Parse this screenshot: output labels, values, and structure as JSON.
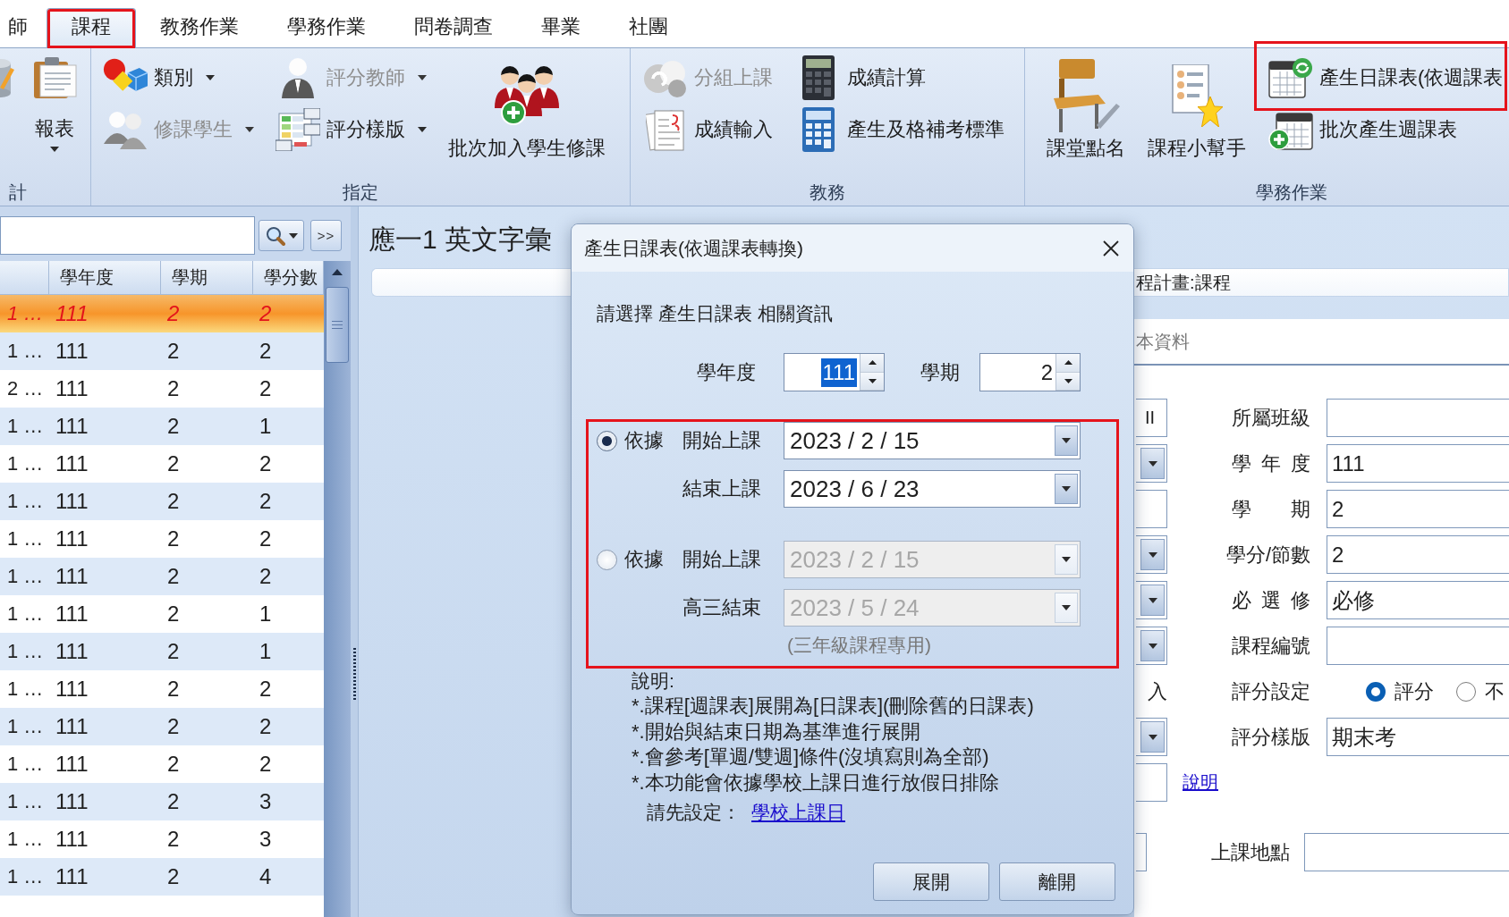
{
  "tabs": [
    {
      "label": "師",
      "selected": false,
      "highlighted": false
    },
    {
      "label": "課程",
      "selected": true,
      "highlighted": true
    },
    {
      "label": "教務作業",
      "selected": false,
      "highlighted": false
    },
    {
      "label": "學務作業",
      "selected": false,
      "highlighted": false
    },
    {
      "label": "問卷調查",
      "selected": false,
      "highlighted": false
    },
    {
      "label": "畢業",
      "selected": false,
      "highlighted": false
    },
    {
      "label": "社團",
      "selected": false,
      "highlighted": false
    }
  ],
  "ribbon": {
    "groups": [
      {
        "label": "計",
        "items": [
          {
            "kind": "large",
            "dropdown": false,
            "disabled": false,
            "highlighted": false
          },
          {
            "kind": "large",
            "label": "報表",
            "dropdown": true,
            "disabled": false,
            "highlighted": false
          }
        ]
      },
      {
        "label": "指定",
        "items": [
          {
            "kind": "small",
            "label": "類別",
            "dropdown": true,
            "disabled": false,
            "highlighted": false
          },
          {
            "kind": "small",
            "label": "修課學生",
            "dropdown": true,
            "disabled": true,
            "highlighted": false
          },
          {
            "kind": "small",
            "label": "評分教師",
            "dropdown": true,
            "disabled": true,
            "highlighted": false
          },
          {
            "kind": "small",
            "label": "評分樣版",
            "dropdown": true,
            "disabled": false,
            "highlighted": false
          },
          {
            "kind": "large",
            "label": "批次加入學生修課",
            "dropdown": false,
            "disabled": false,
            "highlighted": false
          }
        ]
      },
      {
        "label": "教務",
        "items": [
          {
            "kind": "small",
            "label": "分組上課",
            "dropdown": false,
            "disabled": true,
            "highlighted": false
          },
          {
            "kind": "small",
            "label": "成績輸入",
            "dropdown": false,
            "disabled": false,
            "highlighted": false
          },
          {
            "kind": "small",
            "label": "成績計算",
            "dropdown": false,
            "disabled": false,
            "highlighted": false
          },
          {
            "kind": "small",
            "label": "產生及格補考標準",
            "dropdown": false,
            "disabled": false,
            "highlighted": false
          }
        ]
      },
      {
        "label": "學務作業",
        "items": [
          {
            "kind": "large",
            "label": "課堂點名",
            "dropdown": false,
            "disabled": false,
            "highlighted": false
          },
          {
            "kind": "large",
            "label": "課程小幫手",
            "dropdown": false,
            "disabled": false,
            "highlighted": false
          },
          {
            "kind": "small",
            "label": "產生日課表(依週課表",
            "dropdown": false,
            "disabled": false,
            "highlighted": true
          },
          {
            "kind": "small",
            "label": "批次產生週課表",
            "dropdown": false,
            "disabled": false,
            "highlighted": false
          }
        ]
      }
    ]
  },
  "course_list": {
    "forward_button": ">>",
    "columns": [
      "",
      "學年度",
      "學期",
      "學分數"
    ],
    "rows": [
      {
        "cells": [
          "1 …",
          "111",
          "2",
          "2"
        ],
        "selected": true
      },
      {
        "cells": [
          "1 …",
          "111",
          "2",
          "2"
        ],
        "selected": false
      },
      {
        "cells": [
          "2 …",
          "111",
          "2",
          "2"
        ],
        "selected": false
      },
      {
        "cells": [
          "1 …",
          "111",
          "2",
          "1"
        ],
        "selected": false
      },
      {
        "cells": [
          "1 …",
          "111",
          "2",
          "2"
        ],
        "selected": false
      },
      {
        "cells": [
          "1 …",
          "111",
          "2",
          "2"
        ],
        "selected": false
      },
      {
        "cells": [
          "1 …",
          "111",
          "2",
          "2"
        ],
        "selected": false
      },
      {
        "cells": [
          "1 …",
          "111",
          "2",
          "2"
        ],
        "selected": false
      },
      {
        "cells": [
          "1 …",
          "111",
          "2",
          "1"
        ],
        "selected": false
      },
      {
        "cells": [
          "1 …",
          "111",
          "2",
          "1"
        ],
        "selected": false
      },
      {
        "cells": [
          "1 …",
          "111",
          "2",
          "2"
        ],
        "selected": false
      },
      {
        "cells": [
          "1 …",
          "111",
          "2",
          "2"
        ],
        "selected": false
      },
      {
        "cells": [
          "1 …",
          "111",
          "2",
          "2"
        ],
        "selected": false
      },
      {
        "cells": [
          "1 …",
          "111",
          "2",
          "3"
        ],
        "selected": false
      },
      {
        "cells": [
          "1 …",
          "111",
          "2",
          "3"
        ],
        "selected": false
      },
      {
        "cells": [
          "1 …",
          "111",
          "2",
          "4"
        ],
        "selected": false
      }
    ]
  },
  "course_detail": {
    "title": "應一1 英文字彙",
    "breadcrumb": "程計畫:課程",
    "section": "本資料",
    "rows": [
      {
        "kind": "standard",
        "stub": {
          "kind": "text",
          "value": "II"
        },
        "label": "所屬班級",
        "control": {
          "kind": "text"
        }
      },
      {
        "kind": "standard",
        "stub": {
          "kind": "dropdown"
        },
        "label": "學 年 度",
        "control": {
          "kind": "text",
          "value": "111"
        }
      },
      {
        "kind": "standard",
        "stub": {
          "kind": "text"
        },
        "label": "學 期",
        "control": {
          "kind": "text",
          "value": "2"
        }
      },
      {
        "kind": "standard",
        "stub": {
          "kind": "dropdown"
        },
        "label": "學分/節數",
        "control": {
          "kind": "text",
          "value": "2"
        }
      },
      {
        "kind": "standard",
        "stub": {
          "kind": "dropdown"
        },
        "label": "必 選 修",
        "control": {
          "kind": "text",
          "value": "必修"
        }
      },
      {
        "kind": "standard",
        "stub": {
          "kind": "dropdown"
        },
        "label": "課程編號",
        "control": {
          "kind": "text"
        }
      },
      {
        "kind": "standard",
        "stub": {
          "kind": "label",
          "value": "入"
        },
        "label": "評分設定",
        "control": {
          "kind": "radios",
          "options": [
            {
              "label": "評分",
              "selected": true
            },
            {
              "label": "不",
              "selected": false
            }
          ]
        }
      },
      {
        "kind": "standard",
        "stub": {
          "kind": "dropdown"
        },
        "label": "評分樣版",
        "control": {
          "kind": "text",
          "value": "期末考"
        }
      },
      {
        "kind": "link",
        "stub": {
          "kind": "text"
        },
        "link": "說明"
      },
      {
        "kind": "wide",
        "stub": {
          "kind": "text"
        },
        "label": "上課地點",
        "control": {
          "kind": "text"
        }
      }
    ]
  },
  "dialog": {
    "title": "產生日課表(依週課表轉換)",
    "prompt": "請選擇 產生日課表 相關資訊",
    "spinners": [
      {
        "label": "學年度",
        "value": "111",
        "text_selected": true
      },
      {
        "label": "學期",
        "value": "2",
        "text_selected": false
      }
    ],
    "date_options": {
      "highlighted": true,
      "options": [
        {
          "label": "依據",
          "selected": true,
          "disabled": false,
          "dates": [
            {
              "label": "開始上課",
              "value": "2023 / 2 / 15"
            },
            {
              "label": "結束上課",
              "value": "2023 / 6 / 23"
            }
          ]
        },
        {
          "label": "依據",
          "selected": false,
          "disabled": true,
          "dates": [
            {
              "label": "開始上課",
              "value": "2023 / 2 / 15"
            },
            {
              "label": "高三結束",
              "value": "2023 / 5 / 24"
            }
          ],
          "note": "(三年級課程專用)"
        }
      ]
    },
    "help_title": "說明:",
    "help_lines": [
      "*.課程[週課表]展開為[日課表](刪除舊的日課表)",
      "*.開始與結束日期為基準進行展開",
      "*.會參考[單週/雙週]條件(沒填寫則為全部)",
      "*.本功能會依據學校上課日進行放假日排除"
    ],
    "setup": {
      "label": "請先設定：",
      "link": "學校上課日"
    },
    "buttons": [
      "展開",
      "離開"
    ]
  }
}
